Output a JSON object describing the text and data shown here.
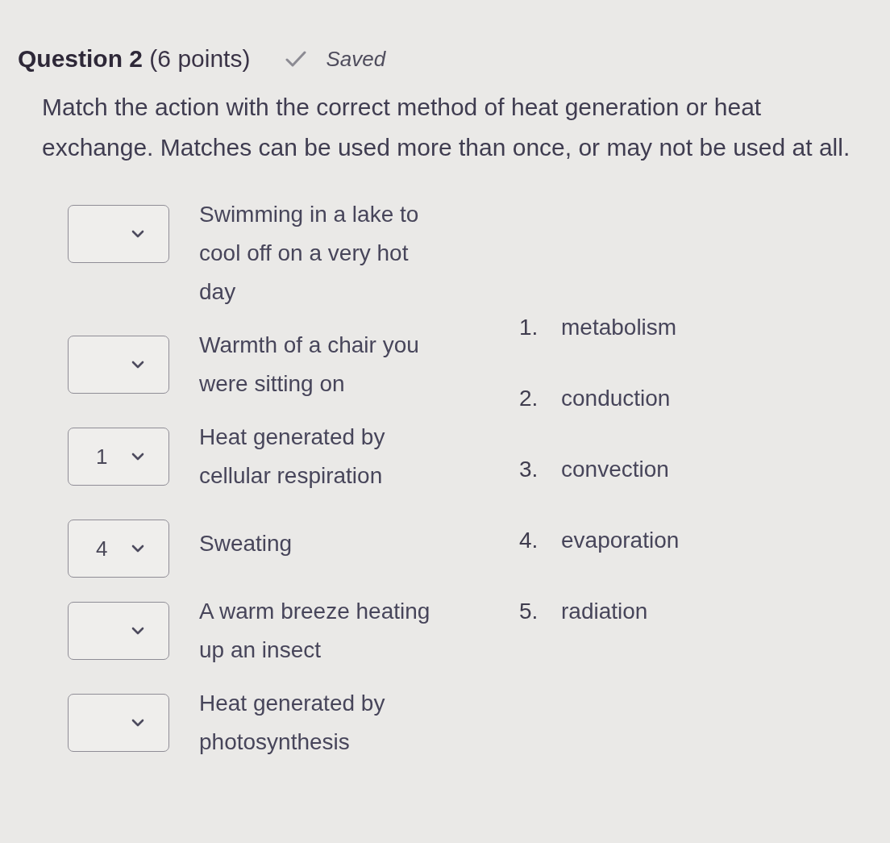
{
  "header": {
    "title": "**Question 2** (6 points)",
    "status": "Saved"
  },
  "prompt": "Match the action with the correct method of heat generation or heat exchange. Matches can be used more than once, or may not be used at all.",
  "items": [
    {
      "text": "Swimming in a lake to cool off on a very hot day"
    },
    {
      "text": "Warmth of a chair you were sitting on"
    },
    {
      "value": "1",
      "text": "Heat generated by cellular respiration"
    },
    {
      "value": "4",
      "text": "Sweating"
    },
    {
      "text": "A warm breeze heating up an insect"
    },
    {
      "text": "Heat generated by photosynthesis"
    }
  ],
  "choices": [
    {
      "number": "1.",
      "label": "metabolism"
    },
    {
      "number": "2.",
      "label": "conduction"
    },
    {
      "number": "3.",
      "label": "convection"
    },
    {
      "number": "4.",
      "label": "evaporation"
    },
    {
      "number": "5.",
      "label": "radiation"
    }
  ]
}
